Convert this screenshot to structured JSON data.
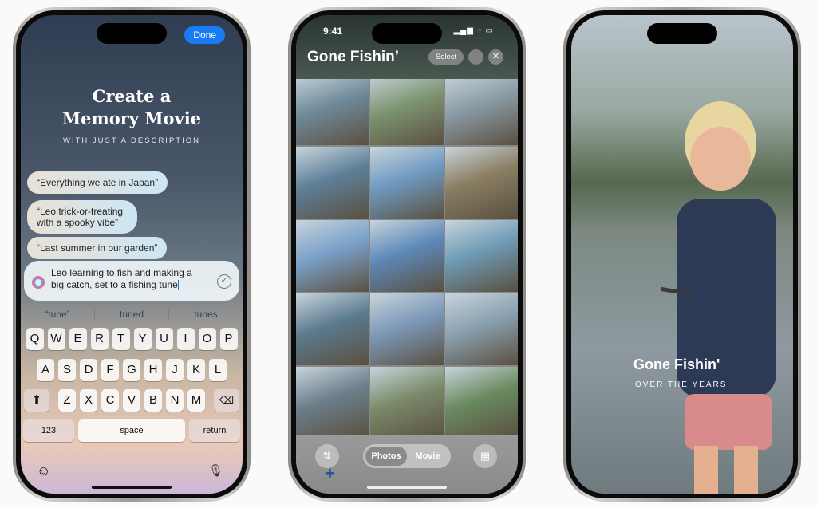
{
  "left_phone": {
    "done": "Done",
    "title_line1": "Create a",
    "title_line2": "Memory Movie",
    "subtitle": "WITH JUST A DESCRIPTION",
    "suggestions": [
      "“Everything we ate in Japan”",
      "“Leo trick-or-treating with a spooky vibe”",
      "“Last summer in our garden”"
    ],
    "input_value": "Leo learning to fish and making a big catch, set to a fishing tune",
    "autocorrect": [
      "“tune”",
      "tuned",
      "tunes"
    ],
    "keys_row1": [
      "Q",
      "W",
      "E",
      "R",
      "T",
      "Y",
      "U",
      "I",
      "O",
      "P"
    ],
    "keys_row2": [
      "A",
      "S",
      "D",
      "F",
      "G",
      "H",
      "J",
      "K",
      "L"
    ],
    "keys_row3": [
      "Z",
      "X",
      "C",
      "V",
      "B",
      "N",
      "M"
    ],
    "key_123": "123",
    "key_space": "space",
    "key_return": "return"
  },
  "middle_phone": {
    "time": "9:41",
    "album_title": "Gone Fishin’",
    "select": "Select",
    "tabs": [
      "Photos",
      "Movie"
    ],
    "active_tab": "Photos",
    "photo_colors": [
      "#6f8a9a",
      "#7d9470",
      "#8a9aa4",
      "#5e7f98",
      "#6e9ac0",
      "#8a7e62",
      "#7aa0c8",
      "#5c88b8",
      "#6e9ab4",
      "#5a7a8e",
      "#7c98b8",
      "#8aa0b0",
      "#6c7e8a",
      "#7a8a6a",
      "#6a8a60"
    ]
  },
  "right_phone": {
    "title": "Gone Fishin'",
    "subtitle": "OVER THE YEARS"
  }
}
